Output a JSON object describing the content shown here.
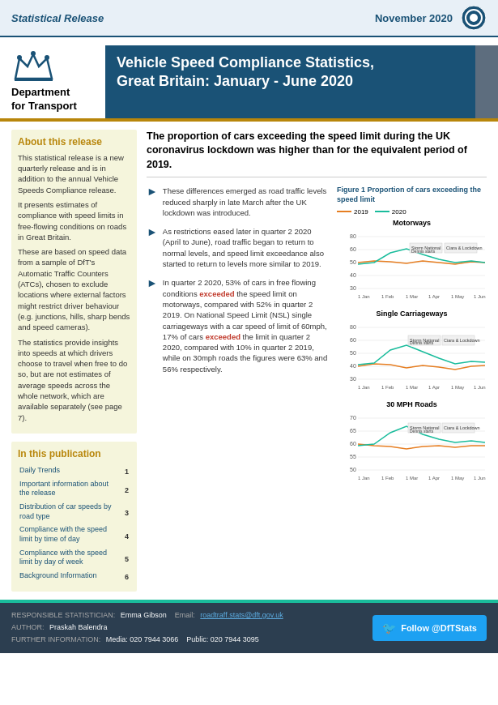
{
  "topbar": {
    "left_label": "Statistical Release",
    "right_label": "November 2020"
  },
  "header": {
    "dept_line1": "Department",
    "dept_line2": "for Transport",
    "title": "Vehicle Speed Compliance Statistics,",
    "subtitle": "Great Britain: January - June 2020"
  },
  "about": {
    "heading": "About this release",
    "paragraphs": [
      "This statistical release is a new quarterly release and is in addition to the annual Vehicle Speeds Compliance release.",
      "It presents estimates of compliance with speed limits in free-flowing conditions on roads in Great Britain.",
      "These are based on speed data from a sample of DfT's Automatic Traffic Counters (ATCs), chosen to exclude locations where external factors might restrict driver behaviour (e.g. junctions, hills, sharp bends and speed cameras).",
      "The statistics provide insights into speeds at which drivers choose to travel when free to do so, but are not estimates of average speeds across the whole network, which are available separately (see page 7)."
    ]
  },
  "publication": {
    "heading": "In this publication",
    "items": [
      {
        "label": "Daily Trends",
        "page": "1"
      },
      {
        "label": "Important information about the release",
        "page": "2"
      },
      {
        "label": "Distribution of car speeds by road type",
        "page": "3"
      },
      {
        "label": "Compliance with the speed limit by time of day",
        "page": "4"
      },
      {
        "label": "Compliance with the speed limit by day of week",
        "page": "5"
      },
      {
        "label": "Background Information",
        "page": "6"
      }
    ]
  },
  "content": {
    "headline": "The proportion of cars exceeding the speed limit during the UK coronavirus lockdown was higher than for the equivalent period of 2019.",
    "bullets": [
      "These differences emerged as road traffic levels reduced sharply in late March after the UK lockdown was introduced.",
      "As restrictions eased later in quarter 2 2020 (April to June), road traffic began to return to normal levels, and speed limit exceedance also started to return to levels more similar to 2019.",
      "In quarter 2 2020, 53% of cars in free flowing conditions exceeded the speed limit on motorways, compared with 52% in quarter 2 2019. On National Speed Limit (NSL) single carriageways with a car speed of limit of 60mph, 17% of cars exceeded the limit in quarter 2 2020, compared with 10% in quarter 2 2019, while on 30mph roads the figures were 63% and 56% respectively."
    ],
    "figure_title": "Figure 1 Proportion of cars exceeding the speed limit",
    "legend": {
      "year2019": "2019",
      "year2020": "2020",
      "color2019": "#e67e22",
      "color2020": "#1abc9c"
    },
    "charts": [
      {
        "title": "Motorways"
      },
      {
        "title": "Single Carriageways"
      },
      {
        "title": "30 MPH Roads"
      }
    ]
  },
  "footer": {
    "stat_label": "RESPONSIBLE STATISTICIAN:",
    "stat_name": "Emma Gibson",
    "author_label": "AUTHOR:",
    "author_name": "Praskah Balendra",
    "info_label": "FURTHER INFORMATION:",
    "info_media": "Media: 020 7944 3066",
    "info_public": "Public: 020 7944 3095",
    "email_label": "Email:",
    "email": "roadtraff.stats@dft.gov.uk",
    "twitter_label": "Follow @DfTStats"
  }
}
